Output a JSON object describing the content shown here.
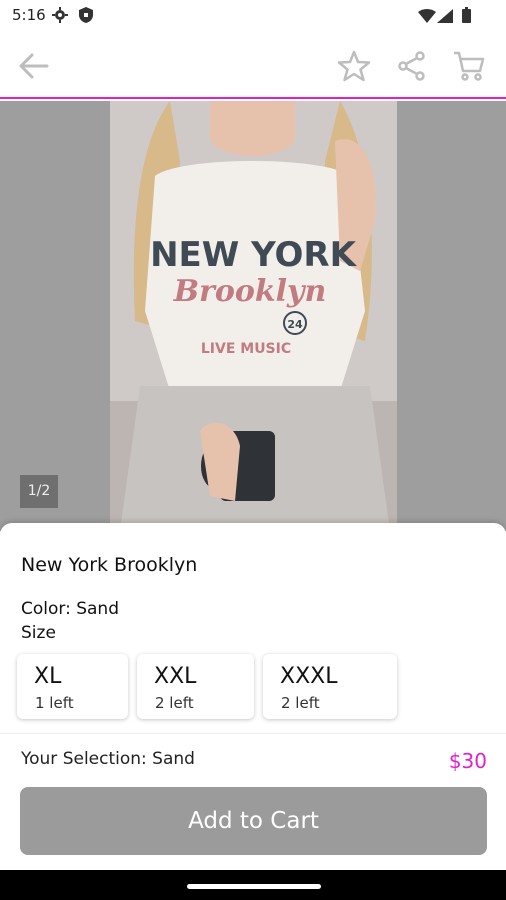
{
  "status_bar": {
    "time": "5:16",
    "icons": [
      "gear-icon",
      "shield-icon",
      "wifi-icon",
      "signal-icon",
      "battery-icon"
    ]
  },
  "top_bar": {
    "icons": [
      "back-arrow-icon",
      "star-icon",
      "share-icon",
      "cart-icon"
    ],
    "accent_color": "#e020d0"
  },
  "gallery": {
    "counter": "1/2",
    "photo_text": {
      "line1": "NEW YORK",
      "line2": "Brooklyn",
      "badge": "24",
      "line3": "LIVE MUSIC"
    }
  },
  "product": {
    "title": "New York Brooklyn",
    "color_label": "Color: Sand",
    "size_label": "Size",
    "sizes": [
      {
        "name": "XL",
        "stock": "1 left"
      },
      {
        "name": "XXL",
        "stock": "2 left"
      },
      {
        "name": "XXXL",
        "stock": "2 left"
      }
    ],
    "selection": "Your Selection: Sand",
    "price": "$30",
    "price_color": "#e020d0"
  },
  "actions": {
    "add_to_cart": "Add to Cart",
    "button_color": "#9b9b9b"
  }
}
